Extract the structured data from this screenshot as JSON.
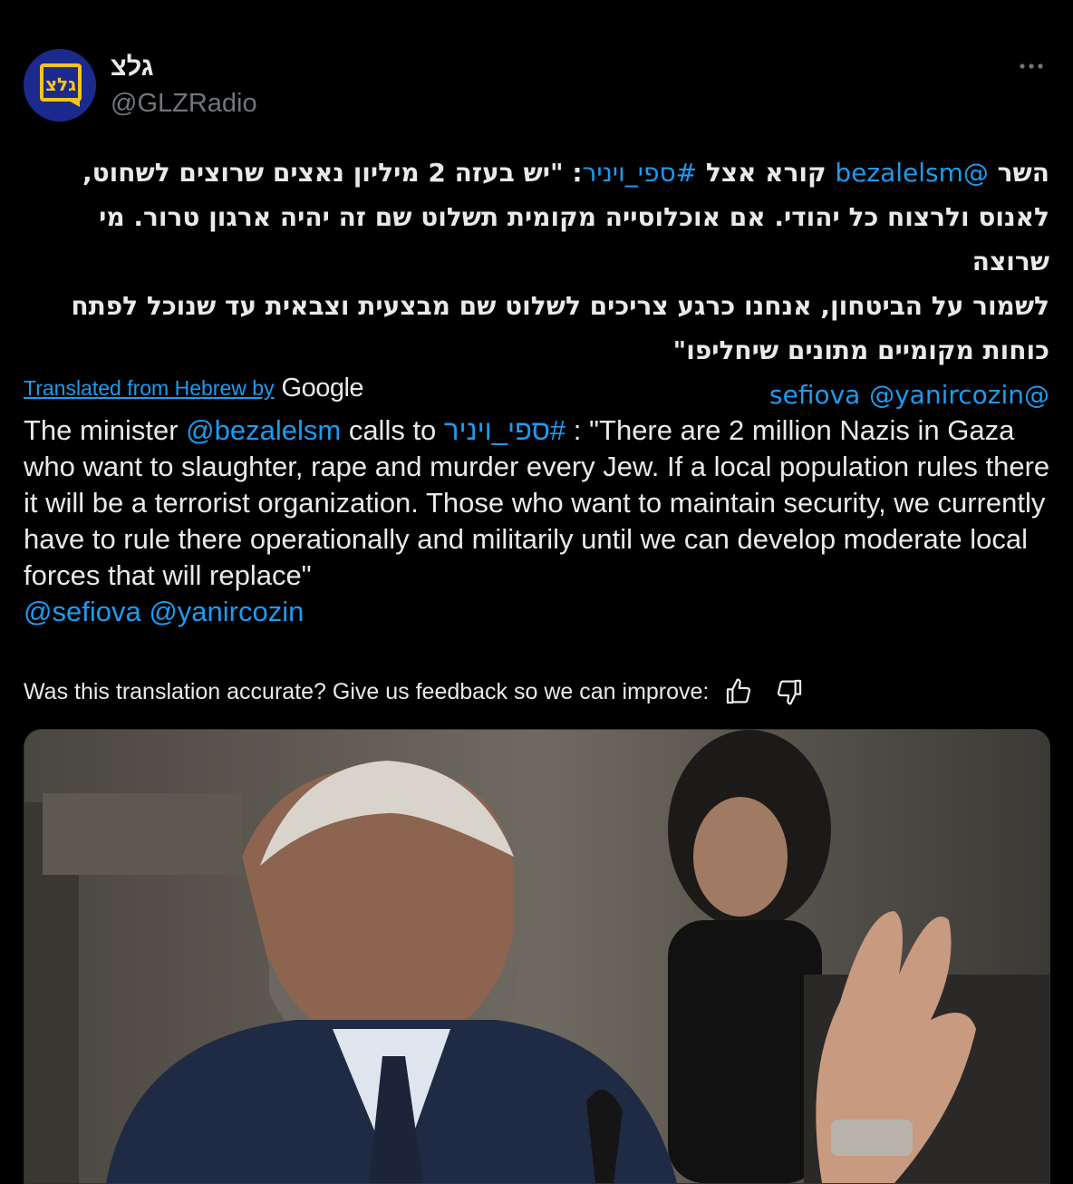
{
  "header": {
    "display_name": "גלצ",
    "handle": "@GLZRadio",
    "avatar_text": "גלצ"
  },
  "tweet": {
    "hebrew_lines": [
      {
        "pre": "השר ",
        "mention": "@bezalelsm",
        "mid": " קורא אצל ",
        "hashtag": "#ספי_ויניר",
        "post": ": \"יש בעזה 2 מיליון נאצים שרוצים לשחוט,"
      },
      {
        "text": "לאנוס ולרצוח כל יהודי. אם אוכלוסייה מקומית תשלוט שם זה יהיה ארגון טרור. מי שרוצה"
      },
      {
        "text": "לשמור על הביטחון, אנחנו כרגע צריכים לשלוט שם מבצעית וצבאית עד שנוכל לפתח"
      },
      {
        "text": "כוחות מקומיים מתונים שיחליפו\""
      }
    ],
    "hebrew_mentions": [
      "@sefiova",
      "@yanircozin"
    ]
  },
  "translation": {
    "label": "Translated from Hebrew by",
    "provider": "Google",
    "text_pre": "The minister ",
    "mention": "@bezalelsm",
    "text_mid": " calls to ",
    "hashtag": "#ספי_ויניר",
    "text_post": " : \"There are 2 million Nazis in Gaza who want to slaughter, rape and murder every Jew. If a local population rules there it will be a terrorist organization. Those who want to maintain security, we currently have to rule there operationally and militarily until we can develop moderate local forces that will replace\"",
    "mentions": [
      "@sefiova",
      "@yanircozin"
    ],
    "feedback_prompt": "Was this translation accurate? Give us feedback so we can improve:"
  },
  "icons": {
    "more": "more-horizontal-icon",
    "thumbs_up": "thumbs-up-icon",
    "thumbs_down": "thumbs-down-icon"
  },
  "colors": {
    "background": "#000000",
    "text": "#e7e9ea",
    "secondary": "#71767b",
    "link": "#1d9bf0",
    "avatar_bg": "#1b2a8c",
    "avatar_accent": "#f5c518"
  }
}
